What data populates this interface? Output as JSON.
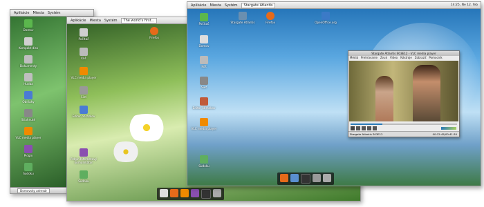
{
  "screen_left": {
    "panel": {
      "menu": [
        "Aplikácie",
        "Miesta",
        "Systém"
      ]
    },
    "icons": [
      "Domov",
      "Kompakt disk",
      "Dokumenty",
      "Hudba",
      "Obrázky",
      "Stiahnuté",
      "VLC media player",
      "Pidgin",
      "Synaptic",
      "Sudoku",
      "Kôš"
    ],
    "taskbar": {
      "task": "Domovsky adresár"
    }
  },
  "screen_middle": {
    "panel": {
      "menu": [
        "Aplikácie",
        "Miesta",
        "Systém"
      ],
      "title": "The world's first..."
    },
    "icons": [
      "Počítač",
      "Kôš",
      "VLC media player",
      "Sieť",
      "Editor obrázkov",
      "Domov",
      "Pidgin Internetový komunikátor",
      "Sudoku",
      "Firefox"
    ]
  },
  "screen_right": {
    "panel": {
      "menu": [
        "Aplikácie",
        "Miesta",
        "Systém"
      ],
      "tab": "Stargate Atlantis",
      "clock": "14:25, Ne 12. feb"
    },
    "icons": [
      "Počítač",
      "Domov",
      "Kôš",
      "Sieť",
      "Editor obrázkov",
      "VLC media player",
      "Sudoku",
      "Stargate Atlantis",
      "Firefox",
      "OpenOffice.org"
    ]
  },
  "vlc": {
    "title": "Stargate Atlantis S03E12 - VLC media player",
    "menu": [
      "Médiá",
      "Prehrávanie",
      "Zvuk",
      "Video",
      "Nástroje",
      "Zobraziť",
      "Pomocník"
    ],
    "status": "Stargate Atlantis S03E12",
    "time": "00:12:45/00:41:30",
    "progress": 0.3
  },
  "colors": {
    "accent": "#2a7ab8",
    "dock_bg": "#222222"
  }
}
